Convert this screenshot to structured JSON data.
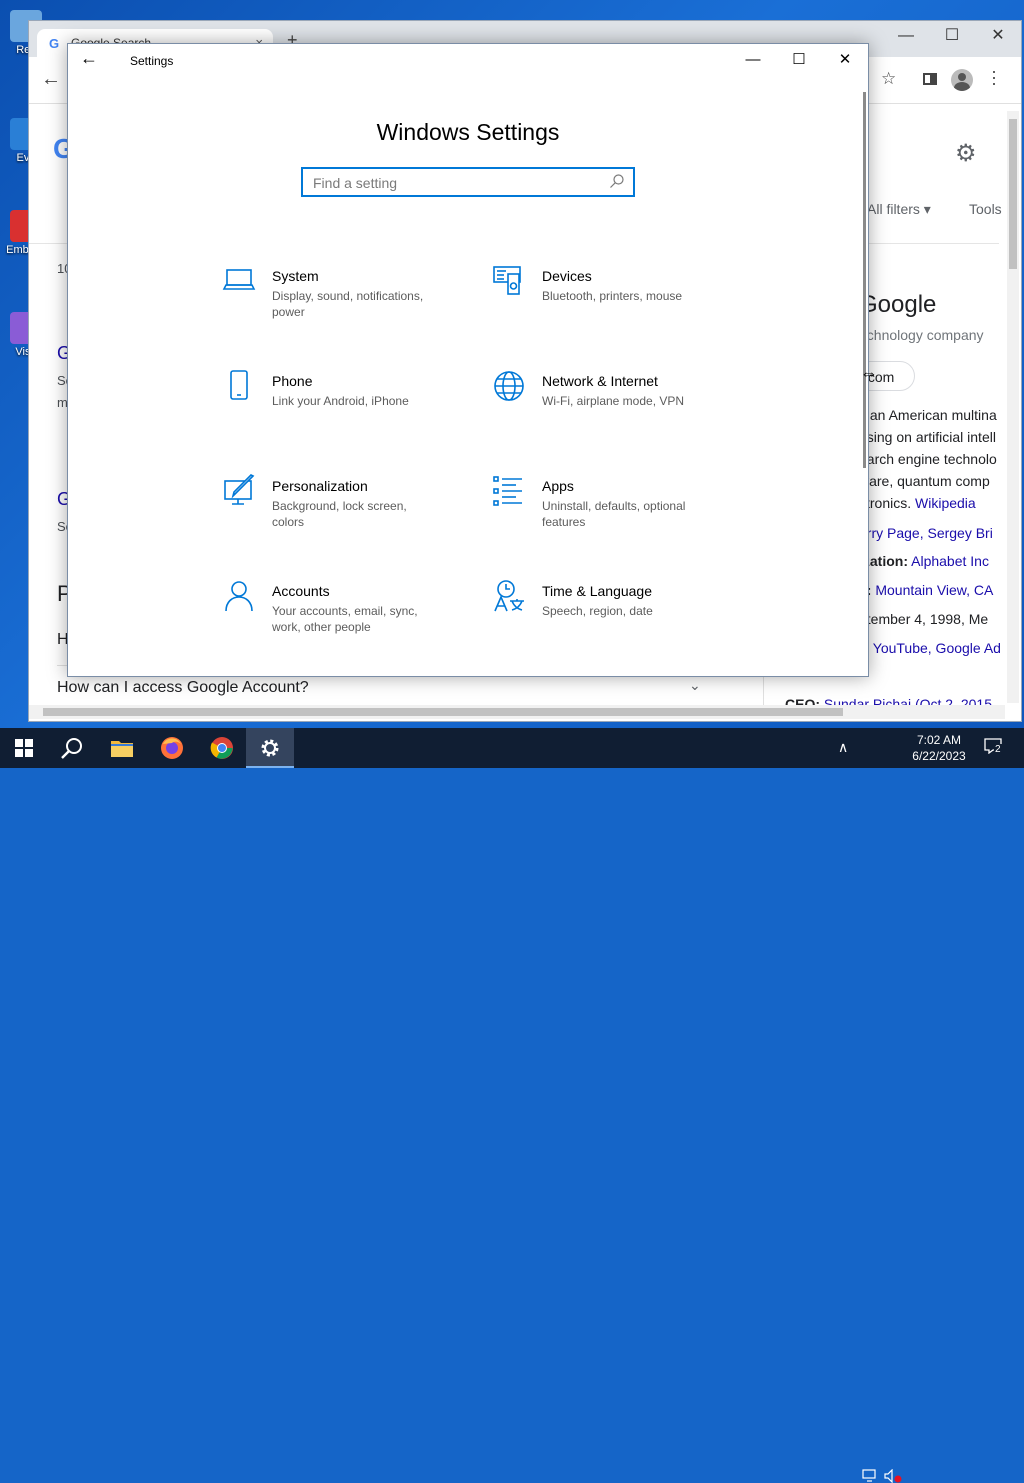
{
  "desktop": {
    "icons": [
      {
        "label": "Rec",
        "color": "#6aa6de"
      },
      {
        "label": "Eve",
        "color": "#2a7fd6"
      },
      {
        "label": "Emb De",
        "color": "#d93030"
      },
      {
        "label": "Visu",
        "color": "#8a5cd6"
      }
    ]
  },
  "chrome": {
    "tab_title": "Google Search",
    "tab_close": "×",
    "new_tab": "+",
    "win_minimize": "—",
    "win_maximize": "☐",
    "win_close": "✕",
    "back_glyph": "←",
    "star_glyph": "☆",
    "page": {
      "logo_letter": "G",
      "gear_glyph": "⚙",
      "all_filters": "All filters ▾",
      "tools": "Tools",
      "left_fragments": [
        "10",
        "G",
        "Se",
        "m",
        "G",
        "Se",
        "P",
        "H"
      ],
      "faq_question": "How can I access Google Account?",
      "faq_chevron": "⌄",
      "knowledge_panel": {
        "title": "Google",
        "subtitle": "echnology company",
        "chip": ".com",
        "lines": [
          {
            "text": "s an American multina"
          },
          {
            "text": "using on artificial intell"
          },
          {
            "text": "earch engine technolo"
          },
          {
            "text": "ware, quantum comp"
          },
          {
            "text": "ctronics.",
            "link": "Wikipedia"
          },
          {
            "link": "arry Page, Sergey Bri"
          },
          {
            "bold": "ization:",
            "link": "Alphabet Inc"
          },
          {
            "bold": "s:",
            "link": "Mountain View, CA"
          },
          {
            "text": "ptember 4, 1998, Me"
          },
          {
            "bold": "r:",
            "link": "YouTube, Google Ad"
          },
          {
            "bold": "CEO:",
            "link": "Sundar Pichai (Oct 2, 2015–"
          }
        ]
      }
    }
  },
  "settings": {
    "window_title": "Settings",
    "back_glyph": "←",
    "win_minimize": "—",
    "win_maximize": "☐",
    "win_close": "✕",
    "heading": "Windows Settings",
    "search_placeholder": "Find a setting",
    "accent": "#0078d7",
    "tiles": [
      {
        "name": "System",
        "desc": "Display, sound, notifications, power",
        "icon": "laptop-icon"
      },
      {
        "name": "Devices",
        "desc": "Bluetooth, printers, mouse",
        "icon": "devices-icon"
      },
      {
        "name": "Phone",
        "desc": "Link your Android, iPhone",
        "icon": "phone-icon"
      },
      {
        "name": "Network & Internet",
        "desc": "Wi-Fi, airplane mode, VPN",
        "icon": "globe-icon"
      },
      {
        "name": "Personalization",
        "desc": "Background, lock screen, colors",
        "icon": "paint-icon"
      },
      {
        "name": "Apps",
        "desc": "Uninstall, defaults, optional features",
        "icon": "apps-list-icon"
      },
      {
        "name": "Accounts",
        "desc": "Your accounts, email, sync, work, other people",
        "icon": "person-icon"
      },
      {
        "name": "Time & Language",
        "desc": "Speech, region, date",
        "icon": "time-language-icon"
      }
    ]
  },
  "taskbar": {
    "clock_time": "7:02 AM",
    "clock_date": "6/22/2023",
    "notification_count": "2",
    "tray_up_glyph": "∧",
    "apps": [
      "start-icon",
      "search-icon",
      "file-explorer-icon",
      "firefox-icon",
      "chrome-icon",
      "settings-gear-icon"
    ]
  }
}
